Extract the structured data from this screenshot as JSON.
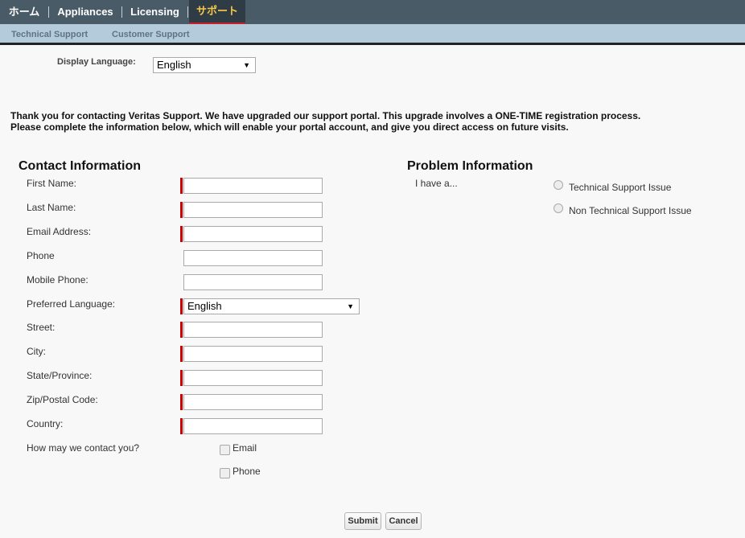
{
  "topnav": {
    "tabs": [
      {
        "label": "ホーム"
      },
      {
        "label": "Appliances"
      },
      {
        "label": "Licensing"
      },
      {
        "label": "サポート"
      }
    ]
  },
  "subnav": {
    "items": [
      {
        "label": "Technical Support"
      },
      {
        "label": "Customer Support"
      }
    ]
  },
  "display_language": {
    "label": "Display Language:",
    "value": "English"
  },
  "intro": {
    "line1": "Thank you for contacting Veritas Support. We have upgraded our support portal. This upgrade involves a ONE-TIME registration process.",
    "line2": "Please complete the information below, which will enable your portal account, and give you direct access on future visits."
  },
  "contact": {
    "title": "Contact Information",
    "first_name": "First Name:",
    "last_name": "Last Name:",
    "email": "Email Address:",
    "phone": "Phone",
    "mobile": "Mobile Phone:",
    "preferred_language": "Preferred Language:",
    "preferred_language_value": "English",
    "street": "Street:",
    "city": "City:",
    "state": "State/Province:",
    "zip": "Zip/Postal Code:",
    "country": "Country:",
    "contact_method": "How may we contact you?",
    "option_email": "Email",
    "option_phone": "Phone"
  },
  "problem": {
    "title": "Problem Information",
    "prompt": "I have a...",
    "option_technical": "Technical Support Issue",
    "option_non_technical": "Non Technical Support Issue"
  },
  "buttons": {
    "submit": "Submit",
    "cancel": "Cancel"
  },
  "colors": {
    "topnav_bg": "#4a5b68",
    "subnav_bg": "#b3cbdb",
    "active_tab_text": "#f6c84a",
    "required_marker": "#cc0000"
  }
}
